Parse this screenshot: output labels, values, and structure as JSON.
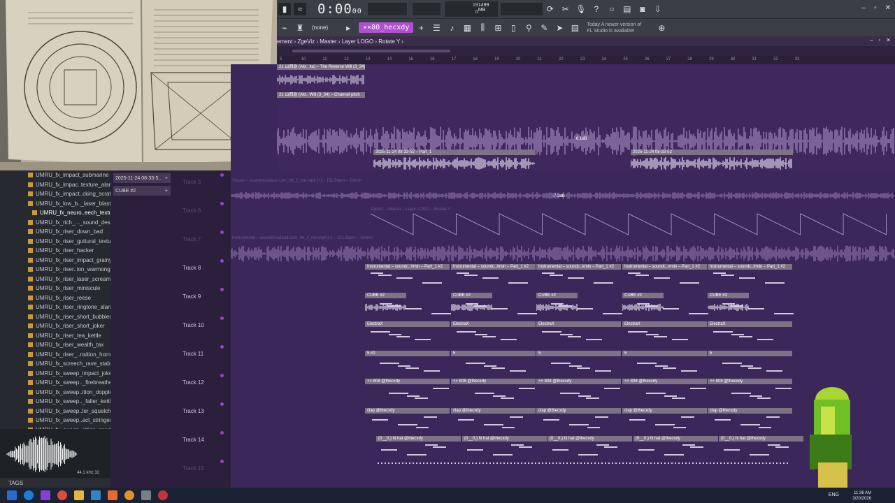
{
  "toolbar": {
    "time_main": "0:00",
    "time_frac": "00",
    "tempo_a": "19",
    "tempo_b": "0",
    "cpu_mem": "1499 MB",
    "pattern_select": "(none)",
    "pattern_name": "××80_hecxdy",
    "update_line1": "Today A newer version of",
    "update_line2": "FL Studio is available!"
  },
  "breadcrumb": {
    "text": "ement › ZgeViz › Master › Layer LOGO › Rotate Y ›"
  },
  "ruler": [
    "5",
    "10",
    "11",
    "12",
    "13",
    "14",
    "15",
    "16",
    "17",
    "18",
    "19",
    "20",
    "21",
    "22",
    "23",
    "24",
    "25",
    "26",
    "27",
    "28",
    "29",
    "30",
    "31",
    "32",
    "33"
  ],
  "top_clips": {
    "clip1": "21 山回返 (Akr.. ka) – The Reverse Will (3_34)",
    "clip2": "21 山回返 (Akr.. Will (3_34) – Channel pitch",
    "audio_ts": "2025-11-24 08-33-52",
    "part1": "2025-11-24 08-33-52 – Part_1",
    "part2": "2025-11-24 08-33-52",
    "gain1": "6.1dB"
  },
  "browser": {
    "items": [
      "UMRU_fx_impact_submarine",
      "UMRU_fx_impac..texture_alarm",
      "UMRU_fx_impact..cking_scratch",
      "UMRU_fx_low_b.._laser_blaster",
      "UMRU_fx_neuro..eech_texture",
      "UMRU_fx_rich_..._sound_design",
      "UMRU_fx_riser_down_bad",
      "UMRU_fx_riser_guttural_texture",
      "UMRU_fx_riser_hacker",
      "UMRU_fx_riser_impact_grainy",
      "UMRU_fx_riser..ion_warmonger",
      "UMRU_fx_riser_laser_scream",
      "UMRU_fx_riser_miniscule",
      "UMRU_fx_riser_reese",
      "UMRU_fx_riser_ringtone_alarm",
      "UMRU_fx_riser_short_bubbler",
      "UMRU_fx_riser_short_joker",
      "UMRU_fx_riser_tea_kettle",
      "UMRU_fx_riser_wealth_tax",
      "UMRU_fx_riser_..nsition_horror",
      "UMRU_fx_screech_rave_stab",
      "UMRU_fx_sweep_impact_joker",
      "UMRU_fx_sweep.._firebreather",
      "UMRU_fx_sweep..ition_doppler",
      "UMRU_fx_sweep.._faller_kettle",
      "UMRU_fx_sweep..ler_squelcher",
      "UMRU_fx_sweep..act_stringent",
      "UMRU_fx_sweep..sition_sparks"
    ],
    "selected_index": 4,
    "tags_label": "TAGS",
    "wave_info": "44.1 kHz 32"
  },
  "channels": [
    "2025-11-24 08-33-5..",
    "CUBE #2"
  ],
  "tracks": [
    {
      "name": "Track 5",
      "dim": true
    },
    {
      "name": "Track 6",
      "dim": true
    },
    {
      "name": "Track 7",
      "dim": true
    },
    {
      "name": "Track 8",
      "dim": false
    },
    {
      "name": "Track 9",
      "dim": false
    },
    {
      "name": "Track 10",
      "dim": false
    },
    {
      "name": "Track 11",
      "dim": false
    },
    {
      "name": "Track 12",
      "dim": false
    },
    {
      "name": "Track 13",
      "dim": false
    },
    {
      "name": "Track 14",
      "dim": false
    },
    {
      "name": "Track 15",
      "dim": true
    }
  ],
  "lane_labels": {
    "vocals": "Vocals – soundcloudaud.com_hit_2_me.mp3 [+] – 151.5bpm – G#min",
    "vocals_gain": "-7.2dB",
    "zgeviz": "ZgeViz – Master – Layer LOGO – Rotate Y",
    "instrumental": "Instrumental – soundcloudaud.com_hit_2_me.mp3 [+] – 151.5bpm – G#min"
  },
  "pattern_rows": {
    "track8": "Instrumental – soundc..#min – Part_1 #2",
    "track9": "CUBE #2",
    "track10": "ElectraX",
    "track11": "5 #2",
    "track11b": "5",
    "track12": "×× 808 @thecxdy",
    "track13": "clap @thecxdy",
    "track14": "(0__0,) hi hat @thecxdy"
  },
  "clock": {
    "time": "11:36 AM",
    "date": "3/20/2026",
    "lang": "ENG"
  }
}
